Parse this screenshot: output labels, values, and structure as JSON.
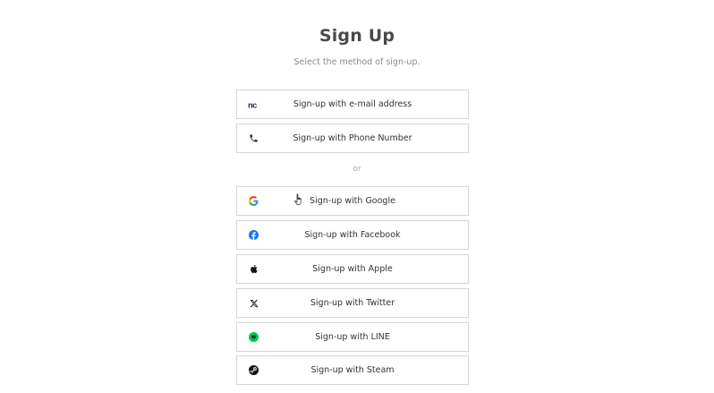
{
  "header": {
    "title": "Sign Up",
    "subtitle": "Select the method of sign-up."
  },
  "primary_methods": [
    {
      "label": "Sign-up with e-mail address",
      "icon": "nc-logo-icon"
    },
    {
      "label": "Sign-up with Phone Number",
      "icon": "phone-icon"
    }
  ],
  "divider": {
    "label": "or"
  },
  "social_methods": [
    {
      "label": "Sign-up with Google",
      "icon": "google-icon"
    },
    {
      "label": "Sign-up with Facebook",
      "icon": "facebook-icon"
    },
    {
      "label": "Sign-up with Apple",
      "icon": "apple-icon"
    },
    {
      "label": "Sign-up with Twitter",
      "icon": "x-twitter-icon"
    },
    {
      "label": "Sign-up with LINE",
      "icon": "line-icon"
    },
    {
      "label": "Sign-up with Steam",
      "icon": "steam-icon"
    }
  ],
  "colors": {
    "nc_logo": "#1e2a55",
    "facebook": "#1877f2",
    "line": "#06c755",
    "google_blue": "#4285f4",
    "google_red": "#ea4335",
    "google_yellow": "#fbbc05",
    "google_green": "#34a853"
  }
}
